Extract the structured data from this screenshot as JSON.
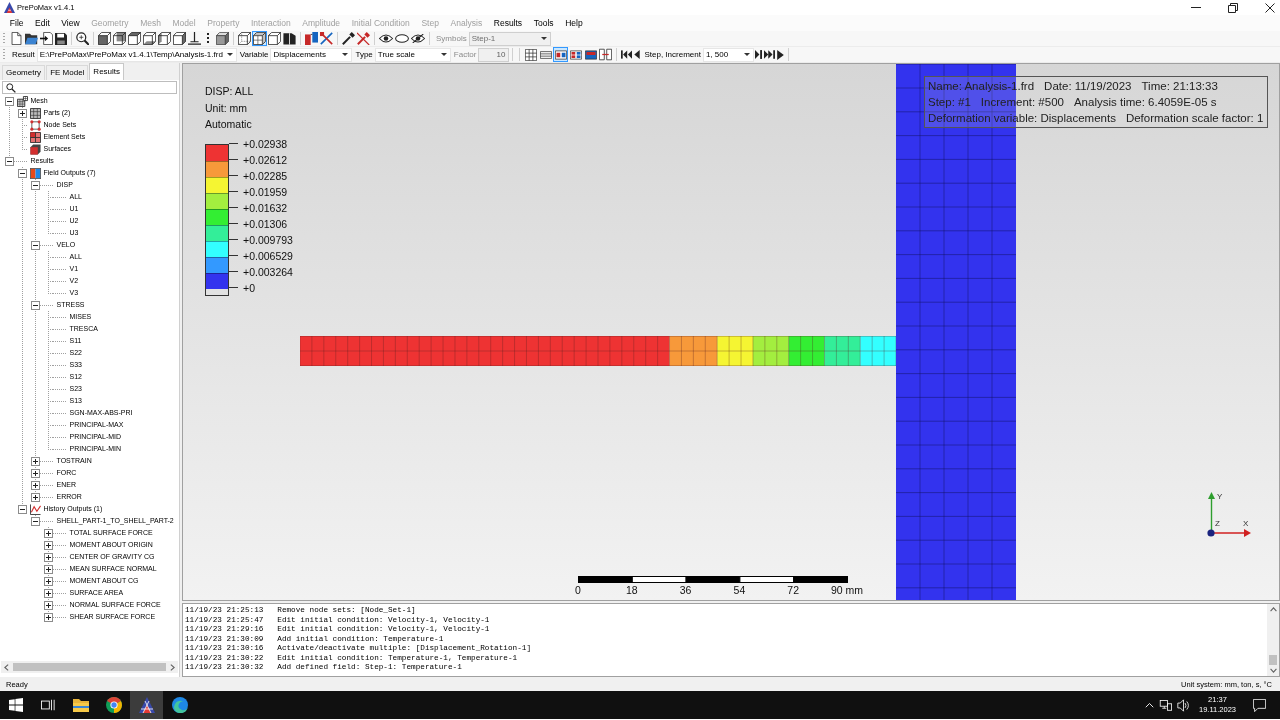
{
  "window": {
    "title": "PrePoMax v1.4.1"
  },
  "menu": [
    {
      "label": "File",
      "disabled": false
    },
    {
      "label": "Edit",
      "disabled": false
    },
    {
      "label": "View",
      "disabled": false
    },
    {
      "label": "Geometry",
      "disabled": true
    },
    {
      "label": "Mesh",
      "disabled": true
    },
    {
      "label": "Model",
      "disabled": true
    },
    {
      "label": "Property",
      "disabled": true
    },
    {
      "label": "Interaction",
      "disabled": true
    },
    {
      "label": "Amplitude",
      "disabled": true
    },
    {
      "label": "Initial Condition",
      "disabled": true
    },
    {
      "label": "Step",
      "disabled": true
    },
    {
      "label": "Analysis",
      "disabled": true
    },
    {
      "label": "Results",
      "disabled": false
    },
    {
      "label": "Tools",
      "disabled": false
    },
    {
      "label": "Help",
      "disabled": false
    }
  ],
  "toolbar": {
    "view_modes": [
      {
        "selected": false
      },
      {
        "selected": true
      },
      {
        "selected": false
      },
      {
        "selected": false
      }
    ],
    "symbols": {
      "label": "Symbols",
      "value": "Step-1",
      "disabled": true
    }
  },
  "results_toolbar": {
    "result": {
      "label": "Result",
      "value": "E:\\PrePoMax\\PrePoMax v1.4.1\\Temp\\Analysis-1.frd"
    },
    "variable": {
      "label": "Variable",
      "value": "Displacements"
    },
    "type": {
      "label": "Type",
      "value": "True scale"
    },
    "factor": {
      "label": "Factor",
      "value": "10",
      "disabled": true
    },
    "display_modes": [
      {
        "selected": false
      },
      {
        "selected": false
      },
      {
        "selected": true
      },
      {
        "selected": false
      },
      {
        "selected": false
      }
    ],
    "step": {
      "label": "Step, Increment",
      "value": "1, 500"
    }
  },
  "tabs": [
    {
      "label": "Geometry",
      "selected": false
    },
    {
      "label": "FE Model",
      "selected": false
    },
    {
      "label": "Results",
      "selected": true
    }
  ],
  "tree": [
    {
      "label": "Mesh",
      "kind": "mesh",
      "expanded": true,
      "children": [
        {
          "label": "Parts (2)",
          "kind": "parts",
          "expanded": false
        },
        {
          "label": "Node Sets",
          "kind": "node_sets"
        },
        {
          "label": "Element Sets",
          "kind": "element_sets"
        },
        {
          "label": "Surfaces",
          "kind": "surfaces"
        }
      ]
    },
    {
      "label": "Results",
      "kind": "group",
      "expanded": true,
      "children": [
        {
          "label": "Field Outputs (7)",
          "kind": "field_outputs",
          "expanded": true,
          "children": [
            {
              "label": "DISP",
              "expanded": true,
              "children": [
                {
                  "label": "ALL"
                },
                {
                  "label": "U1"
                },
                {
                  "label": "U2"
                },
                {
                  "label": "U3"
                }
              ]
            },
            {
              "label": "VELO",
              "expanded": true,
              "children": [
                {
                  "label": "ALL"
                },
                {
                  "label": "V1"
                },
                {
                  "label": "V2"
                },
                {
                  "label": "V3"
                }
              ]
            },
            {
              "label": "STRESS",
              "expanded": true,
              "children": [
                {
                  "label": "MISES"
                },
                {
                  "label": "TRESCA"
                },
                {
                  "label": "S11"
                },
                {
                  "label": "S22"
                },
                {
                  "label": "S33"
                },
                {
                  "label": "S12"
                },
                {
                  "label": "S23"
                },
                {
                  "label": "S13"
                },
                {
                  "label": "SGN-MAX-ABS-PRI"
                },
                {
                  "label": "PRINCIPAL-MAX"
                },
                {
                  "label": "PRINCIPAL-MID"
                },
                {
                  "label": "PRINCIPAL-MIN"
                }
              ]
            },
            {
              "label": "TOSTRAIN",
              "expanded": false
            },
            {
              "label": "FORC",
              "expanded": false
            },
            {
              "label": "ENER",
              "expanded": false
            },
            {
              "label": "ERROR",
              "expanded": false
            }
          ]
        },
        {
          "label": "History Outputs (1)",
          "kind": "history_outputs",
          "expanded": true,
          "children": [
            {
              "label": "SHELL_PART-1_TO_SHELL_PART-2",
              "expanded": true,
              "children": [
                {
                  "label": "TOTAL SURFACE FORCE",
                  "expanded": false
                },
                {
                  "label": "MOMENT ABOUT ORIGIN",
                  "expanded": false
                },
                {
                  "label": "CENTER OF GRAVITY CG",
                  "expanded": false
                },
                {
                  "label": "MEAN SURFACE NORMAL",
                  "expanded": false
                },
                {
                  "label": "MOMENT ABOUT CG",
                  "expanded": false
                },
                {
                  "label": "SURFACE AREA",
                  "expanded": false
                },
                {
                  "label": "NORMAL SURFACE FORCE",
                  "expanded": false
                },
                {
                  "label": "SHEAR SURFACE FORCE",
                  "expanded": false
                }
              ]
            }
          ]
        }
      ]
    }
  ],
  "viewport": {
    "legend": {
      "title": "DISP: ALL",
      "unit": "Unit: mm",
      "scale_mode": "Automatic",
      "bands": [
        {
          "color": "#ee3333"
        },
        {
          "color": "#f7993a"
        },
        {
          "color": "#f5f532"
        },
        {
          "color": "#a3ee3f"
        },
        {
          "color": "#33ee33"
        },
        {
          "color": "#33ee99"
        },
        {
          "color": "#33ffff"
        },
        {
          "color": "#3399ff"
        },
        {
          "color": "#3333ee"
        }
      ],
      "labels": [
        "+0.02938",
        "+0.02612",
        "+0.02285",
        "+0.01959",
        "+0.01632",
        "+0.01306",
        "+0.009793",
        "+0.006529",
        "+0.003264",
        "+0"
      ]
    },
    "info": [
      [
        "Name: Analysis-1.frd",
        "Date: 11/19/2023",
        "Time: 21:13:33"
      ],
      [
        "Step: #1",
        "Increment: #500",
        "Analysis time: 6.4059E-05 s"
      ],
      [
        "Deformation variable: Displacements",
        "Deformation scale factor: 1"
      ]
    ],
    "scale_bar": {
      "labels": [
        "0",
        "18",
        "36",
        "54",
        "72",
        "90 mm"
      ]
    },
    "axes": {
      "y": "Y",
      "z": "Z",
      "x": "X"
    }
  },
  "log": [
    {
      "time": "11/19/23 21:25:13",
      "message": "Remove node sets: [Node_Set-1]"
    },
    {
      "time": "11/19/23 21:25:47",
      "message": "Edit initial condition: Velocity-1, Velocity-1"
    },
    {
      "time": "11/19/23 21:29:16",
      "message": "Edit initial condition: Velocity-1, Velocity-1"
    },
    {
      "time": "11/19/23 21:30:09",
      "message": "Add initial condition: Temperature-1"
    },
    {
      "time": "11/19/23 21:30:16",
      "message": "Activate/deactivate multiple: [Displacement_Rotation-1]"
    },
    {
      "time": "11/19/23 21:30:22",
      "message": "Edit initial condition: Temperature-1, Temperature-1"
    },
    {
      "time": "11/19/23 21:30:32",
      "message": "Add defined field: Step-1: Temperature-1"
    }
  ],
  "status_bar": {
    "message": "Ready",
    "units": "Unit system: mm, ton, s, °C"
  },
  "taskbar": {
    "apps": [
      {
        "selected": false
      },
      {
        "selected": false
      },
      {
        "selected": true
      },
      {
        "selected": false
      }
    ],
    "time": "21:37",
    "date": "19.11.2023"
  }
}
